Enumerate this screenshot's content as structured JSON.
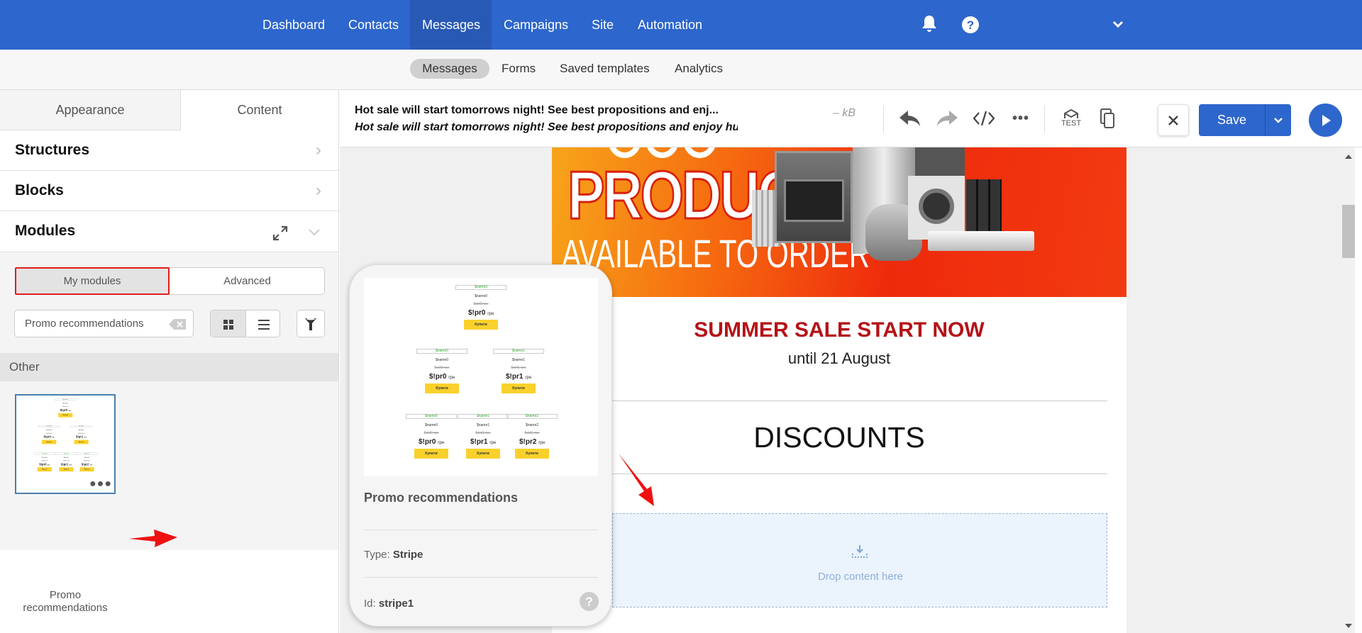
{
  "topnav": {
    "items": [
      "Dashboard",
      "Contacts",
      "Messages",
      "Campaigns",
      "Site",
      "Automation"
    ],
    "active": "Messages",
    "color": "#2d66cc"
  },
  "subnav": {
    "items": [
      "Messages",
      "Forms",
      "Saved templates",
      "Analytics"
    ],
    "active": "Messages"
  },
  "left": {
    "tabs": [
      "Appearance",
      "Content"
    ],
    "active_tab": "Content",
    "sections": [
      "Structures",
      "Blocks",
      "Modules"
    ],
    "module_tabs": [
      "My modules",
      "Advanced"
    ],
    "search_value": "Promo recommendations",
    "group": "Other",
    "module": {
      "name": "Promo recommendations"
    }
  },
  "toolbar": {
    "subject": "Hot sale will start tomorrows night! See best propositions and enj...",
    "preheader": "Hot sale will start tomorrows night! See best propositions and enjoy huge discou",
    "size": "– kB",
    "test_label": "TEST",
    "save_label": "Save"
  },
  "email": {
    "banner_title": "PRODUCTS",
    "banner_sub": "AVAILABLE TO ORDER",
    "headline": "SUMMER SALE START NOW",
    "headline_color": "#b51218",
    "date": "until 21 August",
    "section": "DISCOUNTS",
    "drop_text": "Drop content here"
  },
  "card": {
    "title": "Promo recommendations",
    "type_label": "Type:",
    "type": "Stripe",
    "id_label": "Id:",
    "id": "stripe1"
  },
  "preview": {
    "rows": [
      [
        {
          "img": "$name0",
          "name": "$name0",
          "old": "$old0 грн",
          "price": "$!pr0",
          "cur": "грн",
          "buy": "Купити"
        }
      ],
      [
        {
          "img": "$name0",
          "name": "$name0",
          "old": "$old0 грн",
          "price": "$!pr0",
          "cur": "грн",
          "buy": "Купити"
        },
        {
          "img": "$name1",
          "name": "$name1",
          "old": "$old1 грн",
          "price": "$!pr1",
          "cur": "грн",
          "buy": "Купити"
        }
      ],
      [
        {
          "img": "$name0",
          "name": "$name0",
          "old": "$old0 грн",
          "price": "$!pr0",
          "cur": "грн",
          "buy": "Купити"
        },
        {
          "img": "$name1",
          "name": "$name1",
          "old": "$old1 грн",
          "price": "$!pr1",
          "cur": "грн",
          "buy": "Купити"
        },
        {
          "img": "$name2",
          "name": "$name2",
          "old": "$old2 грн",
          "price": "$!pr2",
          "cur": "грн",
          "buy": "Купити"
        }
      ]
    ]
  },
  "icons": [
    "bell-icon",
    "help-icon",
    "chevron-down-icon",
    "undo-icon",
    "redo-icon",
    "code-icon",
    "more-icon",
    "test-icon",
    "copy-icon",
    "close-icon",
    "play-icon",
    "expand-icon",
    "clear-icon",
    "grid-icon",
    "list-icon",
    "filter-icon",
    "drop-icon"
  ]
}
